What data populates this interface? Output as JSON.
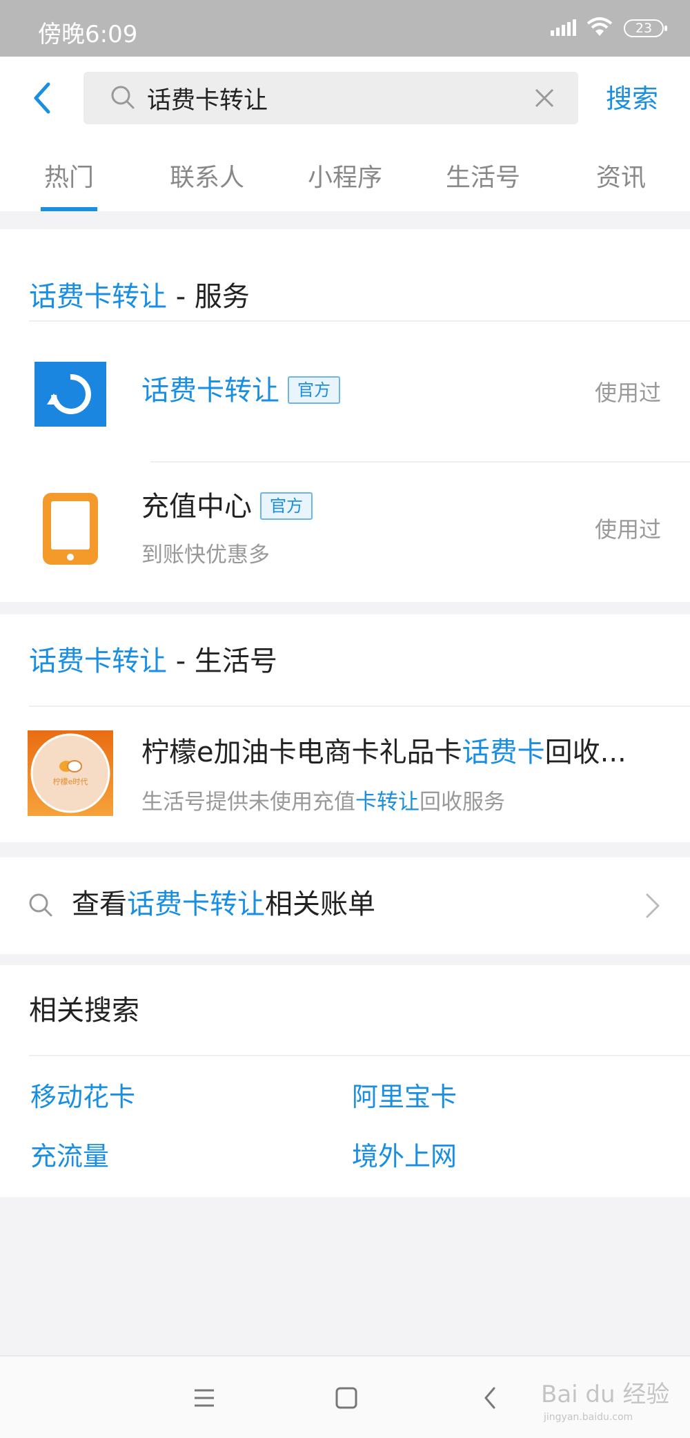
{
  "status_bar": {
    "time": "傍晚6:09",
    "battery": "23"
  },
  "search": {
    "query": "话费卡转让",
    "submit_label": "搜索"
  },
  "tabs": [
    {
      "label": "热门",
      "active": true
    },
    {
      "label": "联系人",
      "active": false
    },
    {
      "label": "小程序",
      "active": false
    },
    {
      "label": "生活号",
      "active": false
    },
    {
      "label": "资讯",
      "active": false
    }
  ],
  "services": {
    "heading_keyword": "话费卡转让",
    "heading_suffix": " - 服务",
    "items": [
      {
        "title": "话费卡转让",
        "badge": "官方",
        "status": "使用过",
        "icon": "refresh-icon",
        "title_color": "#1a8ee1"
      },
      {
        "title": "充值中心",
        "badge": "官方",
        "subtitle": "到账快优惠多",
        "status": "使用过",
        "icon": "phone-icon",
        "title_color": "#222222"
      }
    ]
  },
  "life_account": {
    "heading_keyword": "话费卡转让",
    "heading_suffix": " - 生活号",
    "item": {
      "title_before": "柠檬e加油卡电商卡礼品卡",
      "title_highlight": "话费卡",
      "title_after": "回收...",
      "desc_before": "生活号提供未使用充值",
      "desc_highlight": "卡转让",
      "desc_after": "回收服务",
      "avatar_text": "柠檬e时代"
    }
  },
  "bill_search": {
    "before": "查看",
    "highlight": "话费卡转让",
    "after": "相关账单"
  },
  "related": {
    "heading": "相关搜索",
    "items": [
      "移动花卡",
      "阿里宝卡",
      "充流量",
      "境外上网"
    ]
  },
  "watermark": {
    "brand": "Bai du 经验",
    "url": "jingyan.baidu.com"
  },
  "colors": {
    "accent": "#1a8ee1",
    "page_bg": "#f3f3f6",
    "status_bar": "#b8b8b8"
  }
}
